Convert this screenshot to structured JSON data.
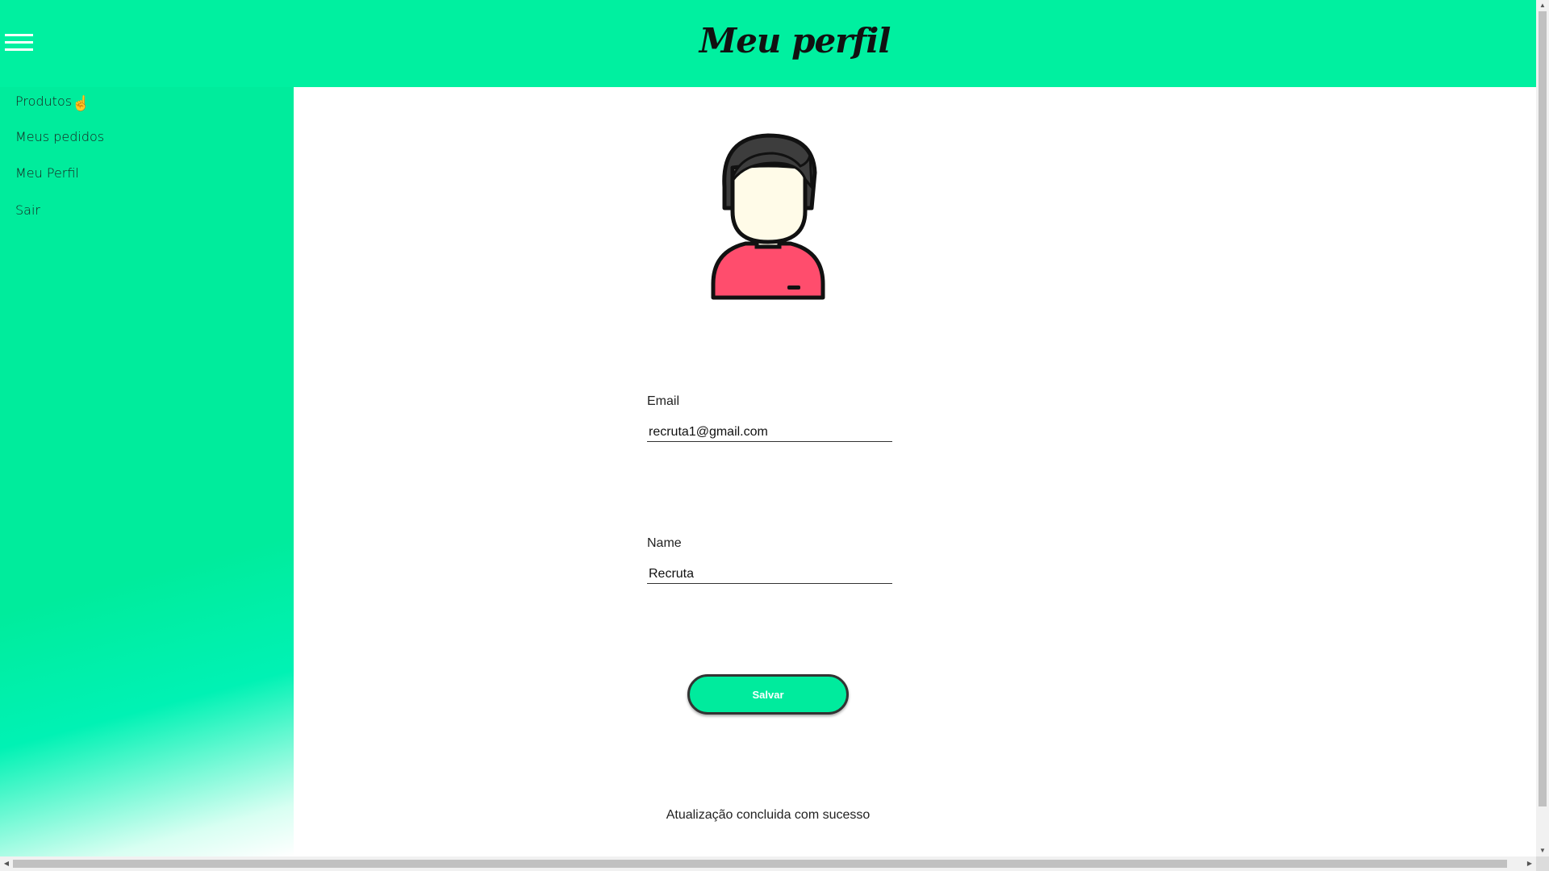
{
  "header": {
    "title": "Meu perfil"
  },
  "sidebar": {
    "items": [
      {
        "label": "Produtos"
      },
      {
        "label": "Meus pedidos"
      },
      {
        "label": "Meu Perfil"
      },
      {
        "label": "Sair"
      }
    ]
  },
  "profile": {
    "email_label": "Email",
    "email_value": "recruta1@gmail.com",
    "name_label": "Name",
    "name_value": "Recruta",
    "save_label": "Salvar",
    "status_message": "Atualização concluida com sucesso"
  },
  "colors": {
    "accent": "#00f0a0",
    "avatar_shirt": "#ff4d6d",
    "avatar_hair": "#3d3d3d",
    "avatar_face": "#fffbe8"
  },
  "icons": {
    "menu": "hamburger-menu-icon",
    "avatar": "user-avatar-icon",
    "cursor": "hand-pointer-icon"
  }
}
